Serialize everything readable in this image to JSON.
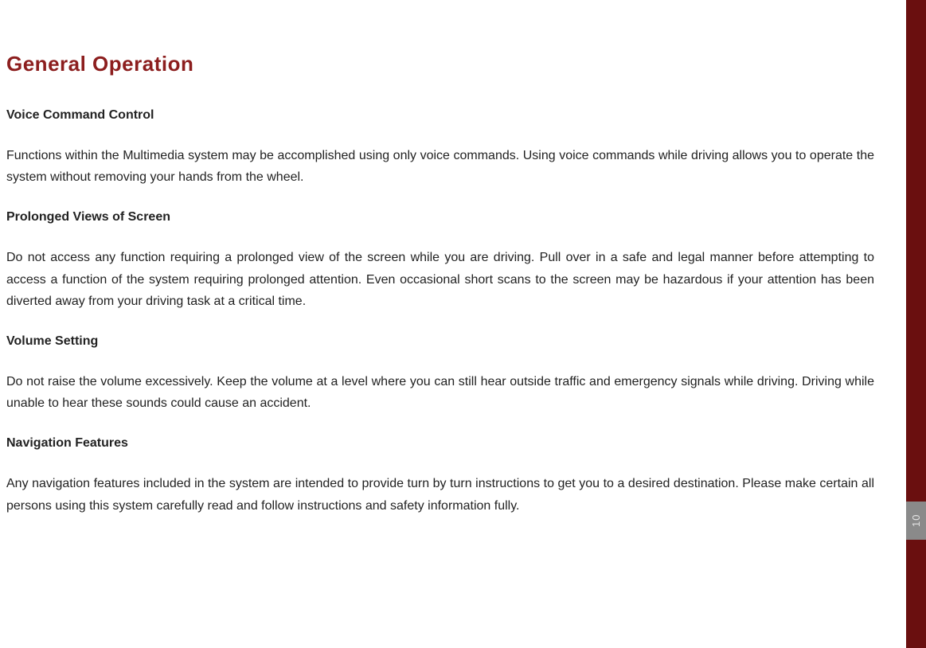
{
  "title": "General Operation",
  "sections": [
    {
      "heading": "Voice Command Control",
      "body": "Functions within the Multimedia system may be accomplished using only voice commands. Using voice commands while driving allows you to operate the system without removing your hands from the wheel."
    },
    {
      "heading": "Prolonged Views of Screen",
      "body": "Do not access any function requiring a prolonged view of the screen while you are driving. Pull over in a safe and legal manner before attempting to access a function of the system requiring prolonged attention. Even occasional short scans to the screen may be hazardous if your attention has been diverted away from your driving task at a critical time."
    },
    {
      "heading": "Volume Setting",
      "body": "Do not raise the volume excessively. Keep the volume at a level where you can still hear outside traffic and emergency signals while driving. Driving while unable to hear these sounds could cause an accident."
    },
    {
      "heading": "Navigation Features",
      "body": "Any navigation features included in the system are intended to provide turn by turn instructions to get you to a desired destination. Please make certain all persons using this system carefully read and follow instructions and safety information fully."
    }
  ],
  "sidebar_tab": "10"
}
